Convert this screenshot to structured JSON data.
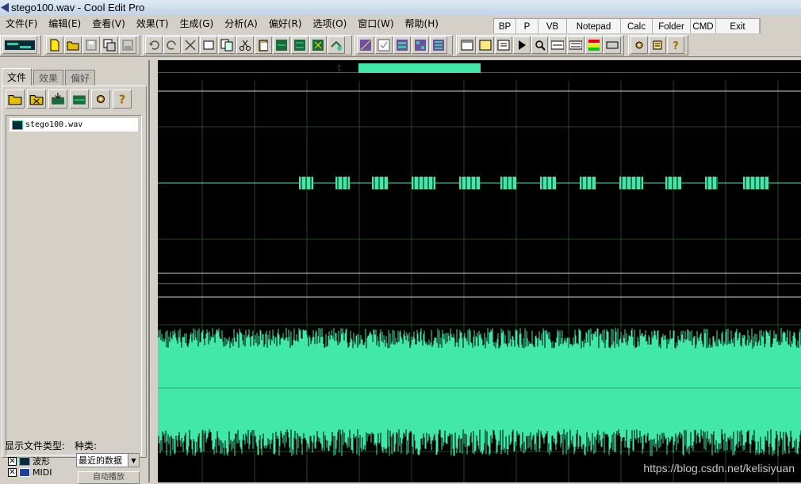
{
  "window": {
    "title": "stego100.wav - Cool Edit Pro"
  },
  "menu": [
    "文件(F)",
    "编辑(E)",
    "查看(V)",
    "效果(T)",
    "生成(G)",
    "分析(A)",
    "偏好(R)",
    "选项(O)",
    "窗口(W)",
    "帮助(H)"
  ],
  "quick_buttons": [
    "BP",
    "P",
    "VB",
    "Notepad",
    "Calc",
    "Folder",
    "CMD",
    "Exit"
  ],
  "left_panel": {
    "tabs": [
      "文件",
      "效果",
      "偏好"
    ],
    "active_tab": "文件",
    "files": [
      "stego100.wav"
    ],
    "show_types_label": "显示文件类型:",
    "kind_label": "种类:",
    "types": [
      {
        "label": "波形",
        "checked": true
      },
      {
        "label": "MIDI",
        "checked": true
      }
    ],
    "kind_select": "最近的数据",
    "auto_play_button": "自动播放"
  },
  "watermark": "https://blog.csdn.net/kelisiyuan",
  "colors": {
    "wave": "#41e8a8",
    "grid": "#1f4a1f",
    "background": "#000000"
  }
}
